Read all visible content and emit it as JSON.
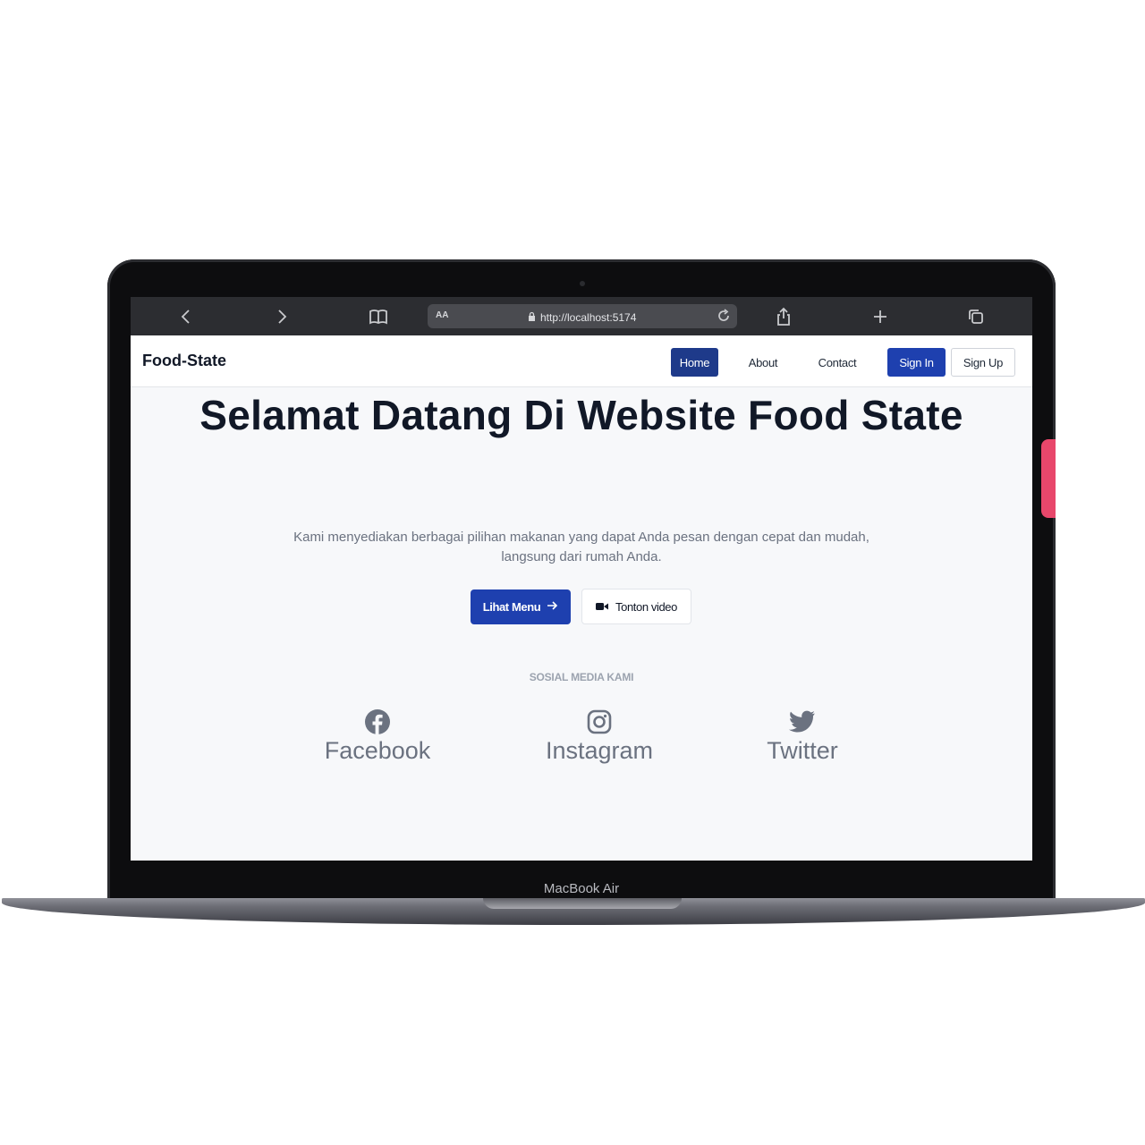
{
  "device": {
    "model_label": "MacBook Air"
  },
  "browser": {
    "text_size_label": "AA",
    "url": "http://localhost:5174",
    "icons": [
      "back-icon",
      "forward-icon",
      "bookmarks-icon",
      "lock-icon",
      "reload-icon",
      "share-icon",
      "new-tab-icon",
      "tabs-icon"
    ]
  },
  "site": {
    "brand": "Food-State",
    "nav": {
      "home": "Home",
      "about": "About",
      "contact": "Contact",
      "sign_in": "Sign In",
      "sign_up": "Sign Up"
    }
  },
  "hero": {
    "title": "Selamat Datang Di Website Food State",
    "subtitle": "Kami menyediakan berbagai pilihan makanan yang dapat Anda pesan dengan cepat dan mudah, langsung dari rumah Anda.",
    "primary_button": "Lihat Menu",
    "secondary_button": "Tonton video"
  },
  "social": {
    "heading": "SOSIAL MEDIA KAMI",
    "items": [
      {
        "label": "Facebook",
        "icon": "facebook-icon"
      },
      {
        "label": "Instagram",
        "icon": "instagram-icon"
      },
      {
        "label": "Twitter",
        "icon": "twitter-icon"
      }
    ]
  },
  "colors": {
    "primary": "#1e40af",
    "home_active": "#1e3a8a",
    "title_text": "#111827",
    "muted_text": "#6b7280",
    "page_background": "#f7f8fa",
    "browser_bar": "#2c2d31",
    "side_tab": "#e8476b"
  }
}
